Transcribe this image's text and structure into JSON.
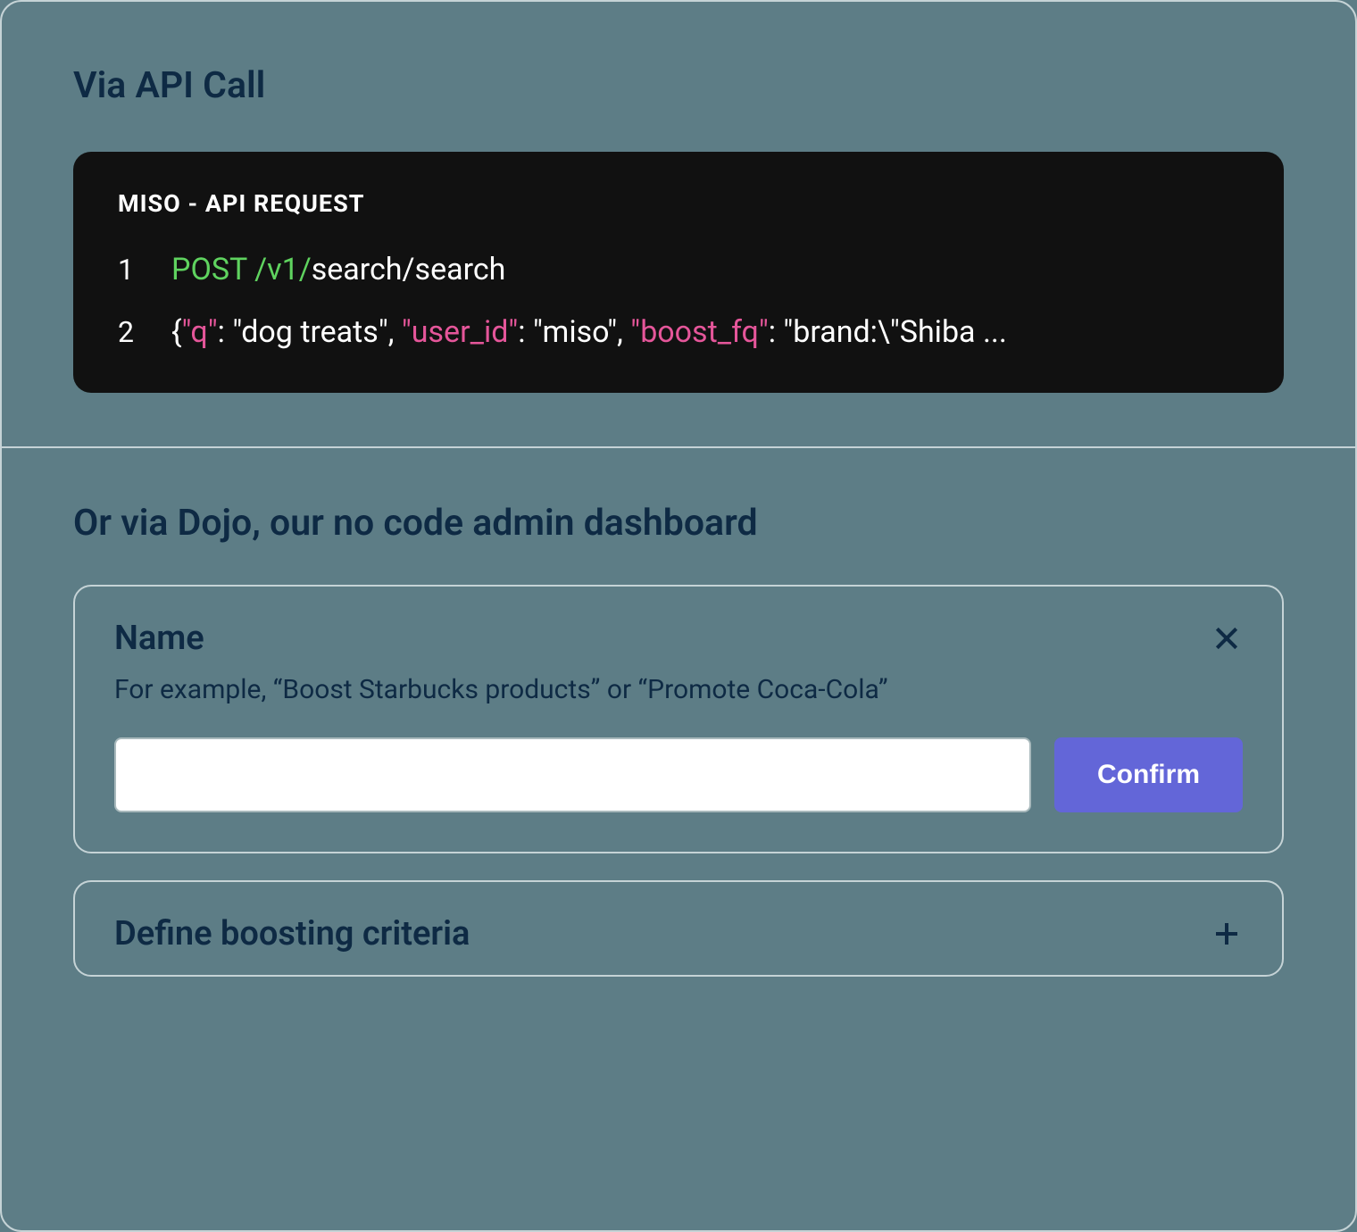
{
  "api_section": {
    "heading": "Via API Call",
    "code_title": "MISO - API REQUEST",
    "line1": {
      "number": "1",
      "method": "POST /v1/",
      "path": "search/search"
    },
    "line2": {
      "number": "2",
      "open": "{",
      "k1": "\"q\"",
      "v1": ": \"dog treats\", ",
      "k2": "\"user_id\"",
      "v2": ": \"miso\", ",
      "k3": "\"boost_fq\"",
      "v3": ": \"brand:\\\"Shiba ..."
    }
  },
  "dojo_section": {
    "heading": "Or via Dojo, our no code admin dashboard",
    "name_card": {
      "title": "Name",
      "hint": "For example, “Boost Starbucks products” or “Promote Coca-Cola”",
      "input_value": "",
      "confirm_label": "Confirm"
    },
    "criteria_card": {
      "title": "Define boosting criteria"
    }
  }
}
